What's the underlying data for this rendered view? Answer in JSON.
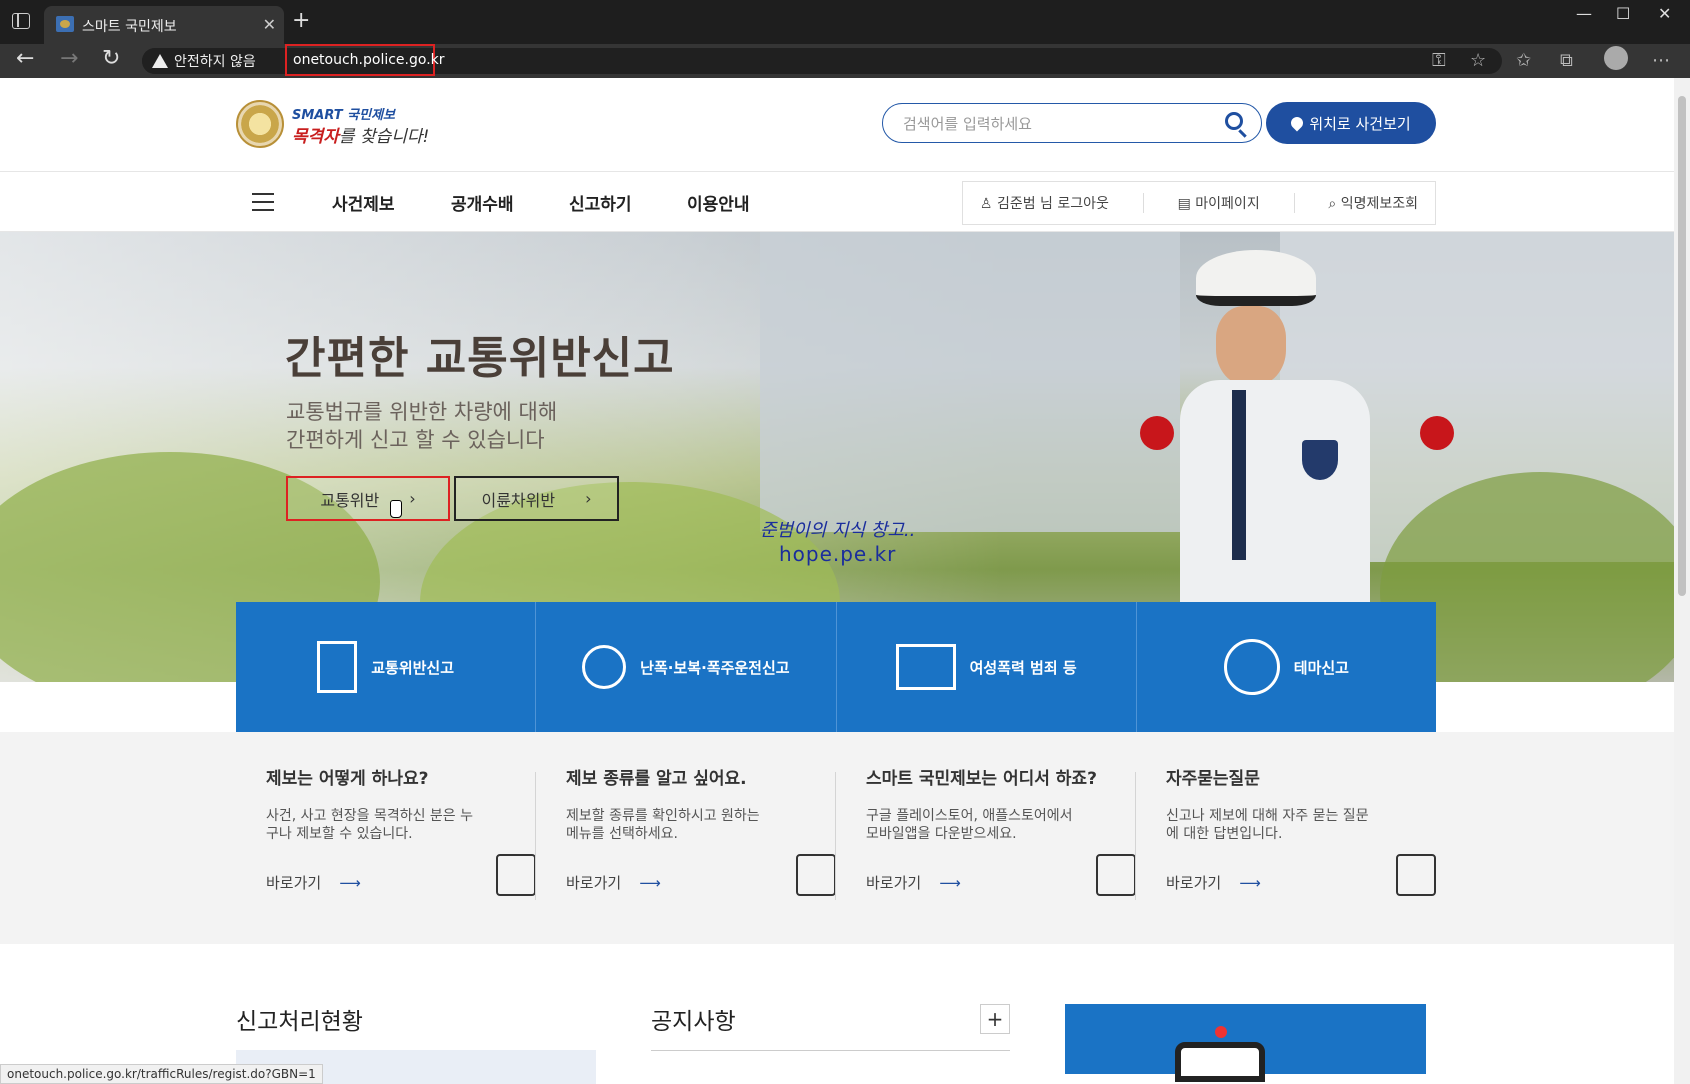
{
  "browser": {
    "tab_title": "스마트 국민제보",
    "security_label": "안전하지 않음",
    "url": "onetouch.police.go.kr",
    "status_url": "onetouch.police.go.kr/trafficRules/regist.do?GBN=1"
  },
  "header": {
    "logo_smart": "SMART 국민제보",
    "logo_tagline_red": "목격자",
    "logo_tagline_rest": "를 찾습니다!",
    "search_placeholder": "검색어를 입력하세요",
    "location_button": "위치로 사건보기"
  },
  "gnb": {
    "items": [
      "사건제보",
      "공개수배",
      "신고하기",
      "이용안내"
    ],
    "util": {
      "user": "김준범 님 로그아웃",
      "mypage": "마이페이지",
      "anon": "익명제보조회"
    }
  },
  "hero": {
    "title": "간편한 교통위반신고",
    "sub1": "교통법규를 위반한 차량에 대해",
    "sub2": "간편하게 신고 할 수 있습니다",
    "btn_traffic": "교통위반",
    "btn_fuel": "이륜차위반",
    "watermark_line1": "준범이의 지식 창고..",
    "watermark_line2": "hope.pe.kr"
  },
  "services": [
    {
      "label": "교통위반신고",
      "icon": "car-document-icon"
    },
    {
      "label": "난폭·보복·폭주운전신고",
      "icon": "angry-car-icon"
    },
    {
      "label": "여성폭력 범죄 등",
      "icon": "shop-shield-icon"
    },
    {
      "label": "테마신고",
      "icon": "thema-pen-icon"
    }
  ],
  "info": [
    {
      "title": "제보는 어떻게 하나요?",
      "desc": "사건, 사고 현장을 목격하신 분은 누구나 제보할 수 있습니다.",
      "link": "바로가기",
      "icon": "megaphone-icon"
    },
    {
      "title": "제보 종류를 알고 싶어요.",
      "desc": "제보할 종류를 확인하시고 원하는 메뉴를 선택하세요.",
      "link": "바로가기",
      "icon": "checklist-icon"
    },
    {
      "title": "스마트 국민제보는 어디서 하죠?",
      "desc": "구글 플레이스토어, 애플스토어에서 모바일앱을 다운받으세요.",
      "link": "바로가기",
      "icon": "phone-icon"
    },
    {
      "title": "자주묻는질문",
      "desc": "신고나 제보에 대해 자주 묻는 질문에 대한 답변입니다.",
      "link": "바로가기",
      "icon": "chat-icon"
    }
  ],
  "bottom": {
    "status_title": "신고처리현황",
    "notice_title": "공지사항",
    "plus": "+"
  },
  "colors": {
    "primary_blue": "#1f4fa0",
    "service_blue": "#1a73c5",
    "highlight_red": "#dd2222"
  }
}
